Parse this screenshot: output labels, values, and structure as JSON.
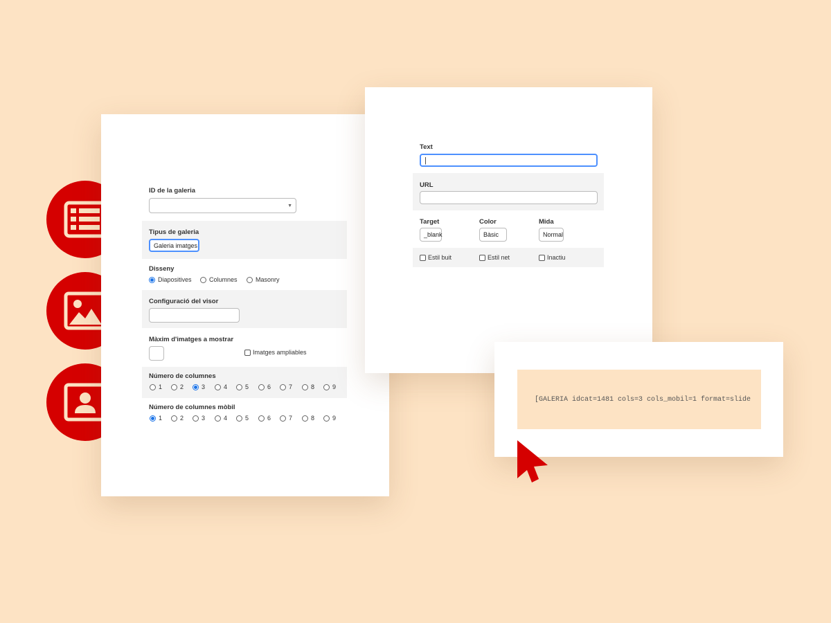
{
  "left_form": {
    "gallery_id": {
      "label": "ID de la galeria",
      "value": ""
    },
    "gallery_type": {
      "label": "Tipus de galeria",
      "value": "Galeria imatges"
    },
    "design": {
      "label": "Disseny",
      "options": [
        "Diapositives",
        "Columnes",
        "Masonry"
      ],
      "selected": "Diapositives"
    },
    "viewer_config": {
      "label": "Configuració del visor",
      "value": ""
    },
    "max_images": {
      "label": "Màxim d'imatges a mostrar",
      "value": "",
      "zoom_checkbox_label": "Imatges ampliables"
    },
    "columns": {
      "label": "Número de columnes",
      "options": [
        "1",
        "2",
        "3",
        "4",
        "5",
        "6",
        "7",
        "8",
        "9"
      ],
      "selected": "3"
    },
    "columns_mobile": {
      "label": "Número de columnes mòbil",
      "options": [
        "1",
        "2",
        "3",
        "4",
        "5",
        "6",
        "7",
        "8",
        "9"
      ],
      "selected": "1"
    }
  },
  "right_form": {
    "text": {
      "label": "Text",
      "value": "|"
    },
    "url": {
      "label": "URL",
      "value": ""
    },
    "target": {
      "label": "Target",
      "value": "_blank"
    },
    "color": {
      "label": "Color",
      "value": "Bàsic"
    },
    "size": {
      "label": "Mida",
      "value": "Normal"
    },
    "checkboxes": [
      "Estil buit",
      "Estil net",
      "Inactiu"
    ]
  },
  "shortcode": "[GALERIA idcat=1481 cols=3 cols_mobil=1 format=slide",
  "side_icons": [
    "table-list-icon",
    "image-icon",
    "contact-card-icon"
  ],
  "colors": {
    "background": "#fde3c4",
    "accent": "#d50000",
    "focus": "#4d90fe",
    "radio": "#1a73e8"
  }
}
